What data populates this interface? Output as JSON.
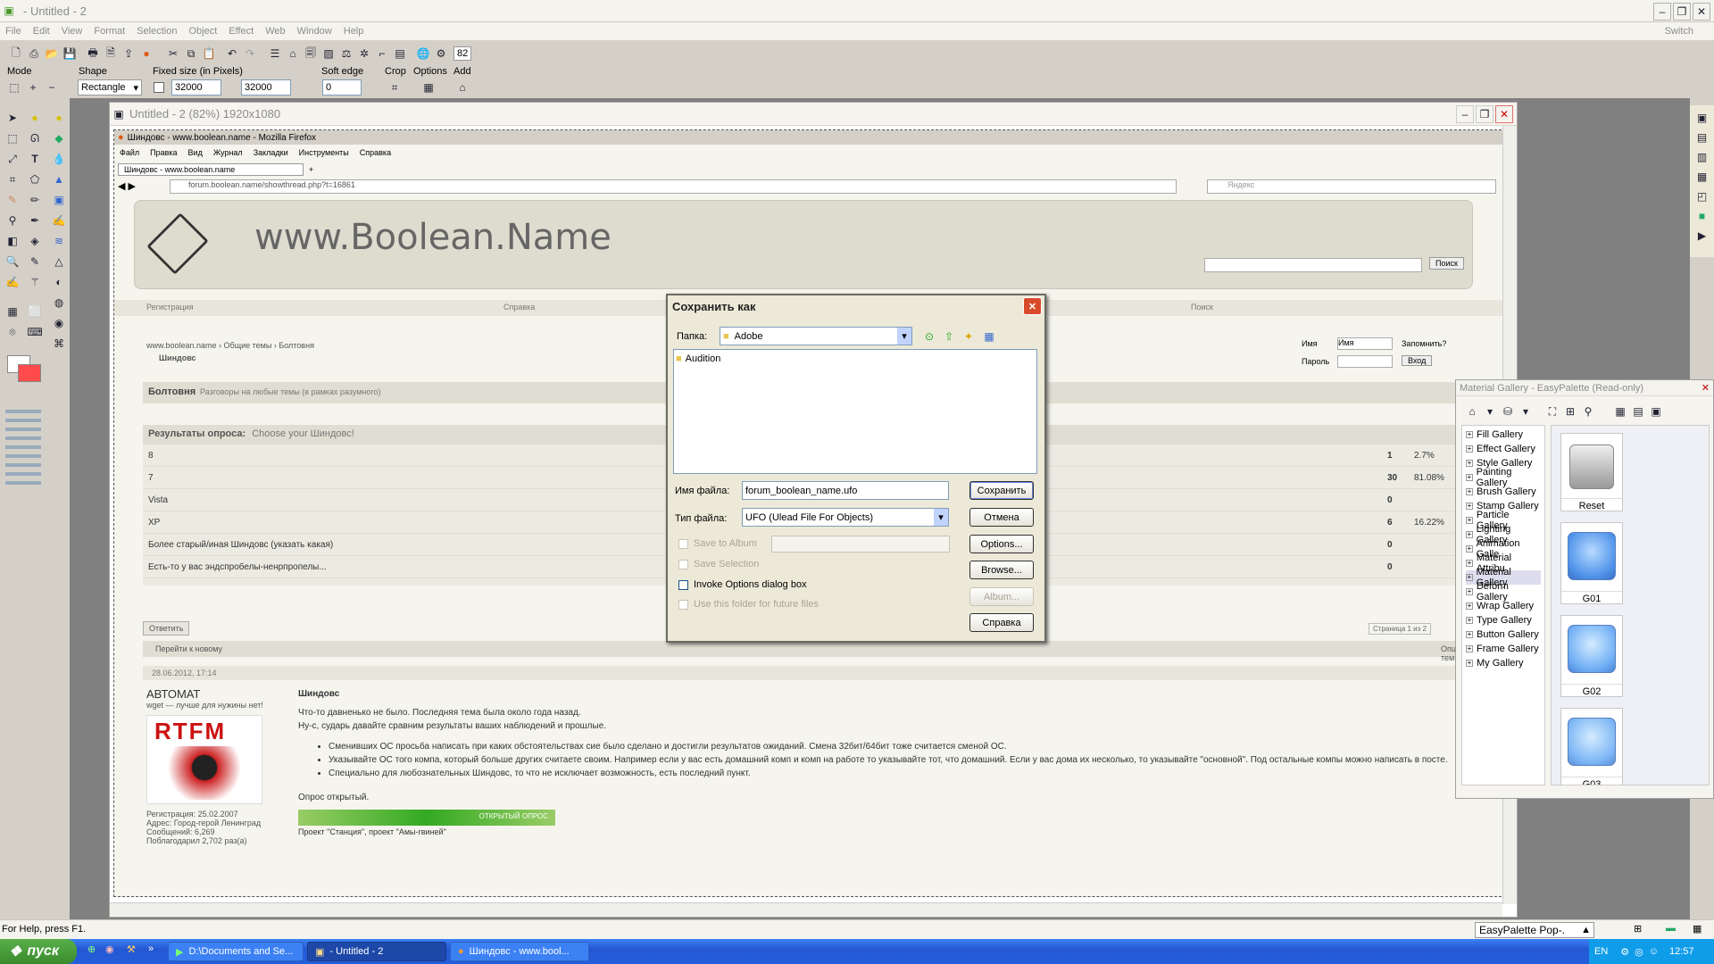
{
  "app": {
    "title": "- Untitled - 2",
    "switch": "Switch",
    "menu": [
      "File",
      "Edit",
      "View",
      "Format",
      "Selection",
      "Object",
      "Effect",
      "Web",
      "Window",
      "Help"
    ],
    "zoom_box": "82"
  },
  "options": {
    "mode": "Mode",
    "shape": "Shape",
    "shape_value": "Rectangle",
    "fixed_size": "Fixed size (in Pixels)",
    "width": "32000",
    "height": "32000",
    "soft_edge": "Soft edge",
    "soft_value": "0",
    "crop": "Crop",
    "options": "Options",
    "add": "Add"
  },
  "doc": {
    "title": "Untitled - 2 (82%) 1920x1080"
  },
  "ff": {
    "title": "Шиндовс - www.boolean.name - Mozilla Firefox",
    "menu": [
      "Файл",
      "Правка",
      "Вид",
      "Журнал",
      "Закладки",
      "Инструменты",
      "Справка"
    ],
    "tab": "Шиндовс - www.boolean.name",
    "url": "forum.boolean.name/showthread.php?t=16861",
    "search_ph": "Яндекс",
    "logo": "www.Boolean.Name",
    "search_btn": "Поиск",
    "nav": [
      "Регистрация",
      "Справка",
      "Поиск"
    ],
    "login_name": "Имя",
    "login_val": "Имя",
    "remember": "Запомнить?",
    "pass": "Пароль",
    "login_btn": "Вход",
    "crumb": "www.boolean.name › Общие темы › Болтовня",
    "crumb2": "Шиндовс",
    "forum_title": "Болтовня",
    "forum_sub": "Разговоры на любые темы (в рамках разумного)",
    "poll_title": "Результаты опроса:",
    "poll_q": "Choose your Шиндовс!",
    "poll": [
      {
        "o": "8",
        "v": "1",
        "p": "2.7%"
      },
      {
        "o": "7",
        "v": "30",
        "p": "81.08%"
      },
      {
        "o": "Vista",
        "v": "0",
        "p": ""
      },
      {
        "o": "XP",
        "v": "6",
        "p": "16.22%"
      },
      {
        "o": "Более старый/иная Шиндовс (указать какая)",
        "v": "0",
        "p": ""
      },
      {
        "o": "Есть-то у вас эндспробелы-ненрпропелы...",
        "v": "0",
        "p": ""
      }
    ],
    "reply": "Ответить",
    "pages": "Страница 1 из 2",
    "p1": "1",
    "p2": "2",
    "goto_new": "Перейти к новому",
    "opts": "Опции темы",
    "post_date": "28.06.2012, 17:14",
    "author": "АВТОМАТ",
    "author_status": "wget — лучше для нужины нет!",
    "rtfm": "RTFM",
    "reg": "Регистрация: 25.02.2007",
    "addr": "Адрес: Город-герой Ленинград",
    "msgs": "Сообщений: 6,269",
    "thanks": "Поблагодарил 2,702 раз(а)",
    "post_title": "Шиндовс",
    "post_lines": [
      "Что-то давненько не было. Последняя тема была около года назад.",
      "Ну-с, сударь давайте сравним результаты ваших наблюдений и прошлые."
    ],
    "bullets": [
      "Сменивших ОС просьба написать при каких обстоятельствах сие было сделано и достигли результатов ожиданий. Смена 32бит/64бит тоже считается сменой ОС.",
      "Указывайте ОС того компа, который больше других считаете своим. Например если у вас есть домашний комп и комп на работе то указывайте тот, что домашний. Если у вас дома их несколько, то указывайте \"основной\". Под остальные компы можно написать в посте.",
      "Специально для любознательных Шиндовс, то что не исключает возможность, есть последний пункт."
    ],
    "closing": "Опрос открытый.",
    "banner": "ОТКРЫТЫЙ ОПРОС",
    "projects": "Проект \"Станция\", проект \"Амы-гвиней\""
  },
  "dialog": {
    "title": "Сохранить как",
    "folder_label": "Папка:",
    "folder": "Adobe",
    "item": "Audition",
    "fname_label": "Имя файла:",
    "fname": "forum_boolean_name.ufo",
    "ftype_label": "Тип файла:",
    "ftype": "UFO (Ulead File For Objects)",
    "save": "Сохранить",
    "cancel": "Отмена",
    "options": "Options...",
    "browse": "Browse...",
    "album": "Album...",
    "help": "Справка",
    "save_album": "Save to Album",
    "save_sel": "Save Selection",
    "invoke": "Invoke Options dialog box",
    "use_folder": "Use this folder for future files"
  },
  "palette": {
    "title": "Material Gallery - EasyPalette (Read-only)",
    "items": [
      "Fill Gallery",
      "Effect Gallery",
      "Style Gallery",
      "Painting Gallery",
      "Brush Gallery",
      "Stamp Gallery",
      "Particle Gallery",
      "Lighting Gallery",
      "Animation Galle",
      "Material Attribu",
      "Material Gallery",
      "Deform Gallery",
      "Wrap Gallery",
      "Type Gallery",
      "Button Gallery",
      "Frame Gallery",
      "My Gallery"
    ],
    "swatches": [
      "Reset",
      "G01",
      "G02",
      "G03"
    ]
  },
  "status": {
    "help": "For Help, press F1.",
    "easy": "EasyPalette Pop-."
  },
  "taskbar": {
    "start": "пуск",
    "tasks": [
      "D:\\Documents and Se...",
      "- Untitled - 2",
      "Шиндовс - www.bool..."
    ],
    "lang": "EN",
    "time": "12:57"
  }
}
